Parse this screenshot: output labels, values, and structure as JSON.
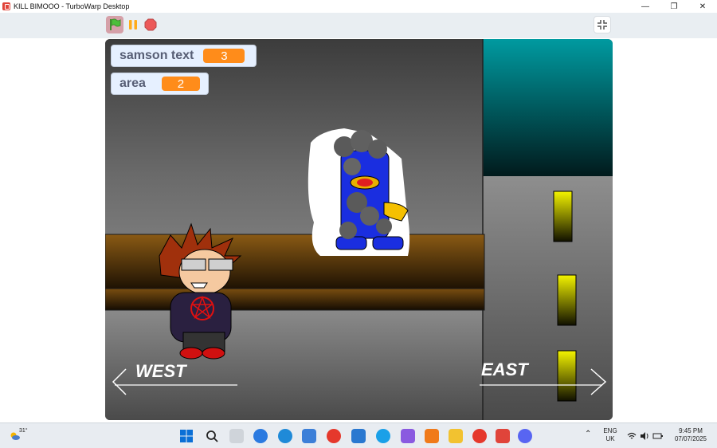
{
  "window": {
    "title": "KILL BIMOOO - TurboWarp Desktop",
    "controls": {
      "minimize": "—",
      "restore": "❐",
      "close": "✕"
    }
  },
  "toolbar": {
    "icons": [
      "green-flag-icon",
      "pause-icon",
      "stop-icon",
      "exit-fullscreen-icon"
    ]
  },
  "stage": {
    "monitors": [
      {
        "label": "samson text",
        "value": "3"
      },
      {
        "label": "area",
        "value": "2"
      }
    ],
    "signs": {
      "west": "WEST",
      "east": "EAST"
    }
  },
  "taskbar": {
    "weather": "31°",
    "language": "ENG",
    "region": "UK",
    "time": "9:45 PM",
    "date": "07/07/2025"
  },
  "colors": {
    "accent_orange": "#ff8c1a",
    "monitor_bg": "#e6f0ff",
    "toolbar_bg": "#e9eef2",
    "brand_red": "#e0443a"
  }
}
